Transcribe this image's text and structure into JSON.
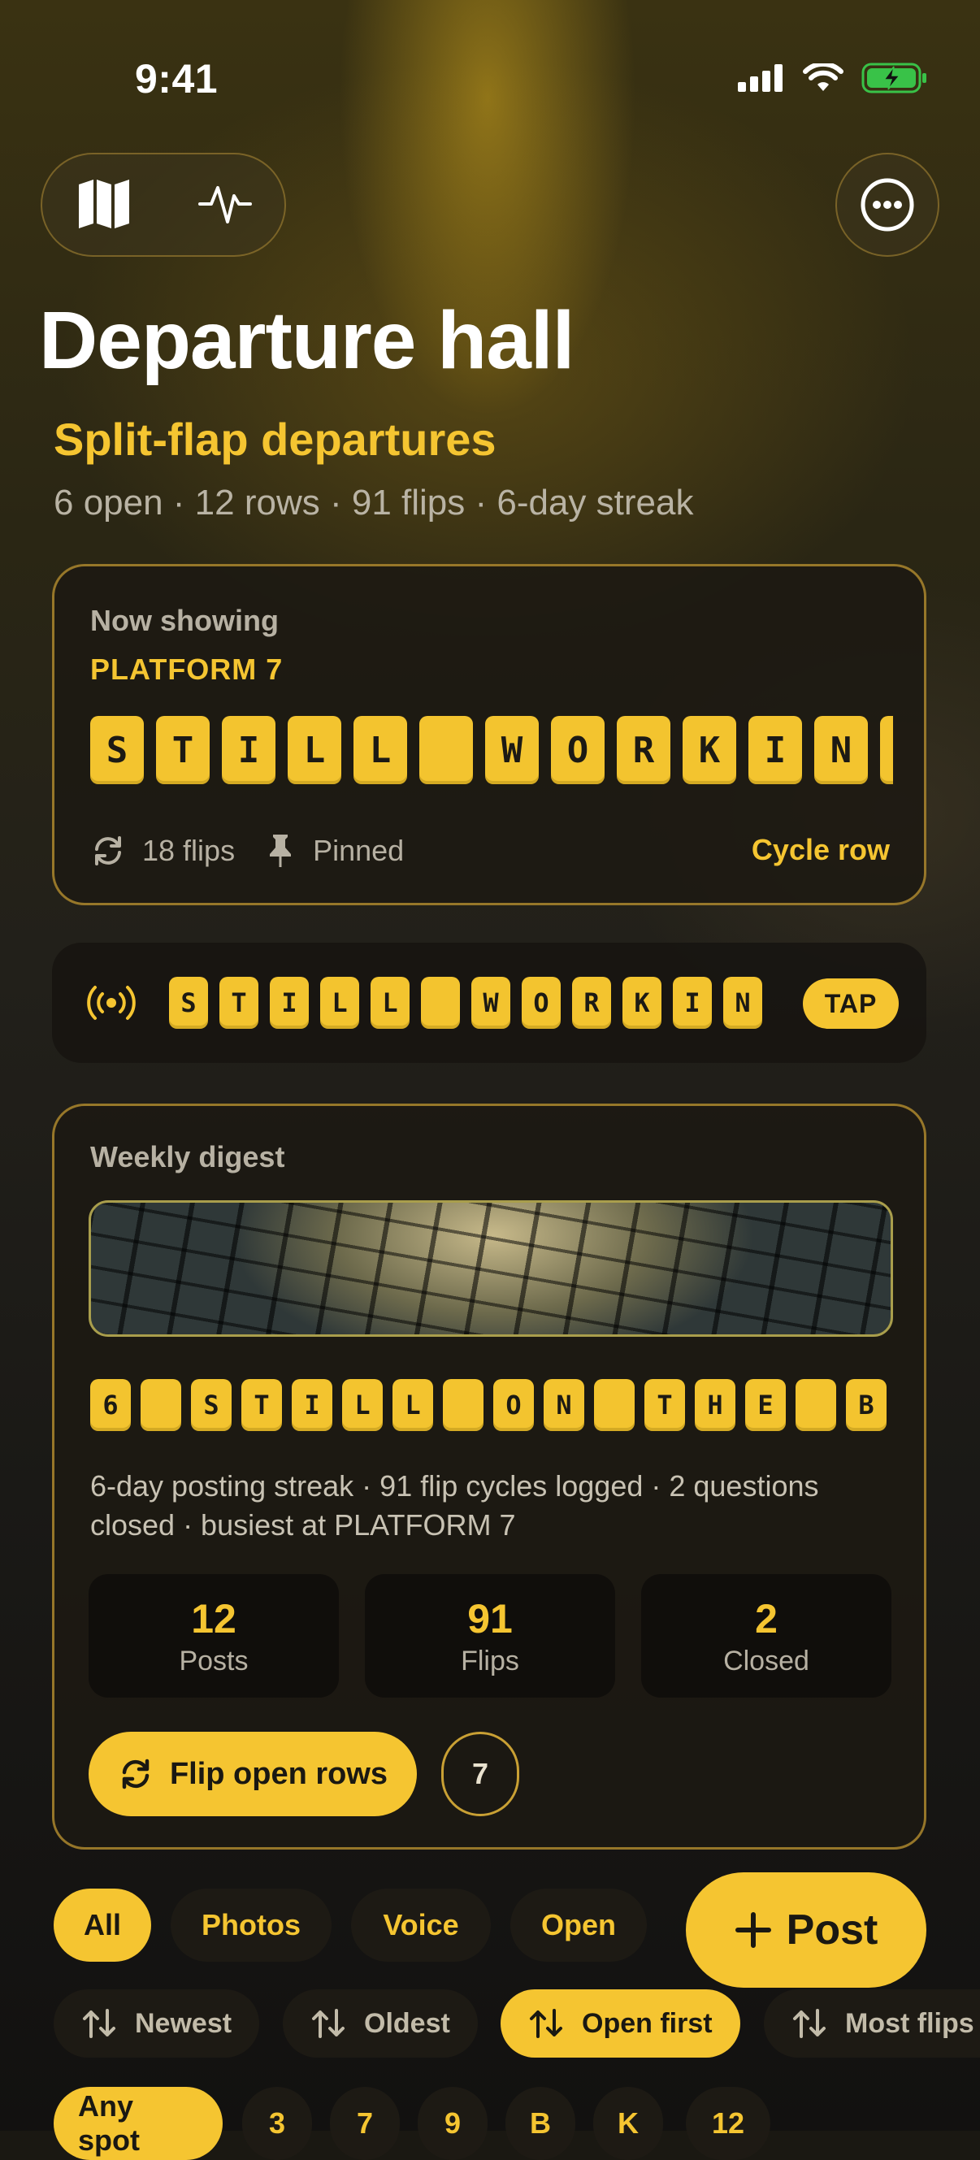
{
  "status": {
    "time": "9:41"
  },
  "header": {
    "title": "Departure hall",
    "subtitle": "Split-flap departures",
    "meta": "6 open · 12 rows · 91 flips · 6-day streak"
  },
  "now_showing": {
    "label": "Now showing",
    "platform": "PLATFORM 7",
    "tiles": [
      "S",
      "T",
      "I",
      "L",
      "L",
      " ",
      "W",
      "O",
      "R",
      "K",
      "I",
      "N",
      ""
    ],
    "flips": "18 flips",
    "pinned": "Pinned",
    "cycle_label": "Cycle row"
  },
  "strip": {
    "tiles": [
      "S",
      "T",
      "I",
      "L",
      "L",
      " ",
      "W",
      "O",
      "R",
      "K",
      "I",
      "N"
    ],
    "tap_label": "TAP"
  },
  "digest": {
    "label": "Weekly digest",
    "tiles": [
      "6",
      " ",
      "S",
      "T",
      "I",
      "L",
      "L",
      " ",
      "O",
      "N",
      " ",
      "T",
      "H",
      "E",
      " ",
      "B"
    ],
    "text": "6-day posting streak · 91 flip cycles logged · 2 questions closed · busiest at PLATFORM 7",
    "stats": [
      {
        "value": "12",
        "label": "Posts"
      },
      {
        "value": "91",
        "label": "Flips"
      },
      {
        "value": "2",
        "label": "Closed"
      }
    ],
    "flip_button": "Flip open rows",
    "open_count": "7"
  },
  "filters": [
    "All",
    "Photos",
    "Voice",
    "Open"
  ],
  "post_button": "Post",
  "sort": [
    "Newest",
    "Oldest",
    "Open first",
    "Most flips"
  ],
  "spots": [
    "Any spot",
    "3",
    "7",
    "9",
    "B",
    "K",
    "12"
  ],
  "colors": {
    "accent": "#f5c531",
    "background": "#1a1812"
  }
}
